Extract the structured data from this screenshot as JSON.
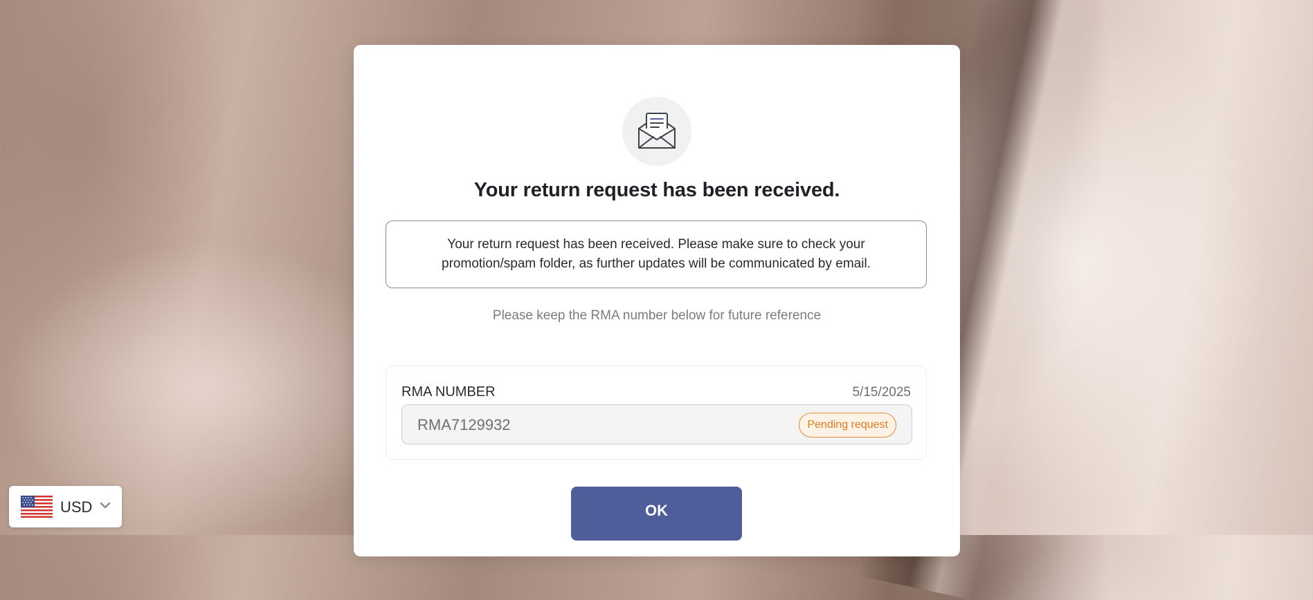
{
  "modal": {
    "icon": "envelope-letter-icon",
    "title": "Your return request has been received.",
    "notice": "Your return request has been received. Please make sure to check your promotion/spam folder, as further updates will be communicated by email.",
    "keep_note": "Please keep the RMA number below for future reference",
    "rma": {
      "label": "RMA NUMBER",
      "date": "5/15/2025",
      "number": "RMA7129932",
      "status": "Pending request"
    },
    "ok_label": "OK"
  },
  "currency_selector": {
    "flag": "us-flag-icon",
    "code": "USD",
    "chevron": "chevron-down-icon"
  },
  "colors": {
    "button": "#4f5d9b",
    "badge": "#e07a1f",
    "title": "#1f2127"
  }
}
